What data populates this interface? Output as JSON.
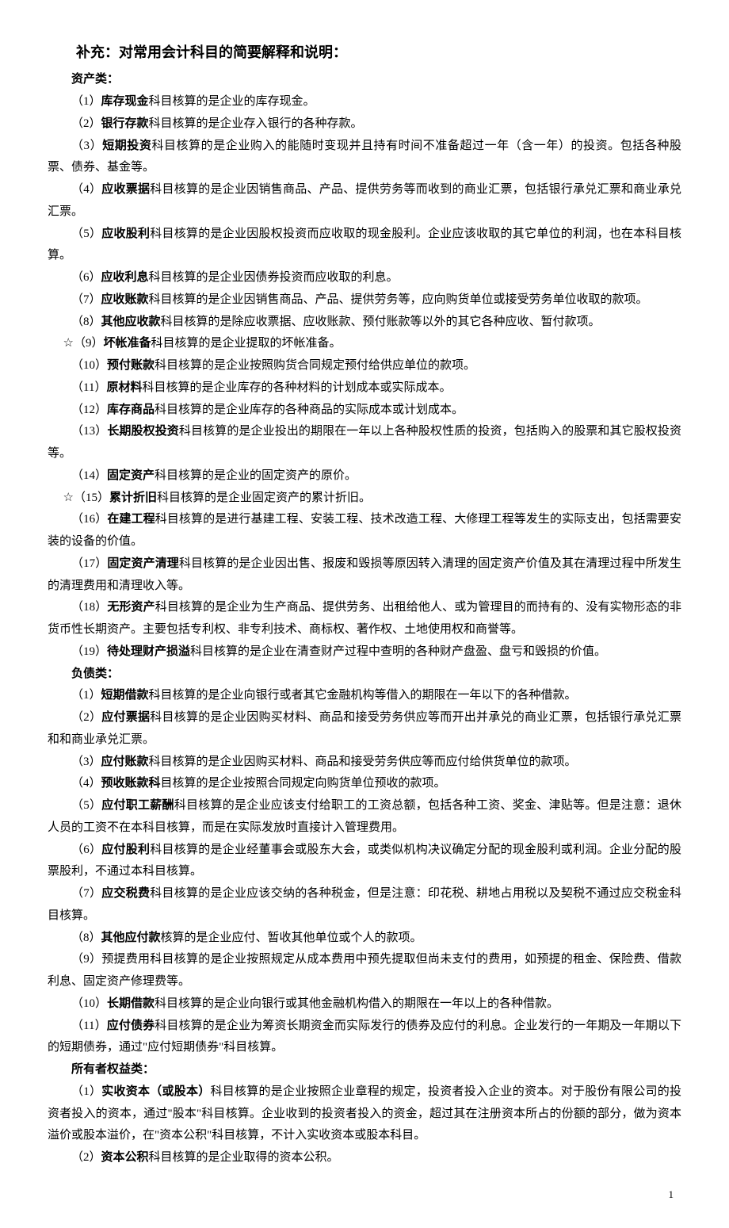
{
  "title": "补充：对常用会计科目的简要解释和说明：",
  "sections": [
    {
      "category": "资产类：",
      "items": [
        {
          "prefix": "（1）",
          "term": "库存现金",
          "rest": "科目核算的是企业的库存现金。"
        },
        {
          "prefix": "（2）",
          "term": "银行存款",
          "rest": "科目核算的是企业存入银行的各种存款。"
        },
        {
          "prefix": "（3）",
          "term": "短期投资",
          "rest": "科目核算的是企业购入的能随时变现并且持有时间不准备超过一年（含一年）的投资。包括各种股票、债券、基金等。"
        },
        {
          "prefix": "（4）",
          "term": "应收票据",
          "rest": "科目核算的是企业因销售商品、产品、提供劳务等而收到的商业汇票，包括银行承兑汇票和商业承兑汇票。"
        },
        {
          "prefix": "（5）",
          "term": "应收股利",
          "rest": "科目核算的是企业因股权投资而应收取的现金股利。企业应该收取的其它单位的利润，也在本科目核算。"
        },
        {
          "prefix": "（6）",
          "term": "应收利息",
          "rest": "科目核算的是企业因债券投资而应收取的利息。"
        },
        {
          "prefix": "（7）",
          "term": "应收账款",
          "rest": "科目核算的是企业因销售商品、产品、提供劳务等，应向购货单位或接受劳务单位收取的款项。"
        },
        {
          "prefix": "（8）",
          "term": "其他应收款",
          "rest": "科目核算的是除应收票据、应收账款、预付账款等以外的其它各种应收、暂付款项。"
        },
        {
          "prefix": "☆（9）",
          "term": "坏帐准备",
          "rest": "科目核算的是企业提取的坏帐准备。",
          "outdent": true
        },
        {
          "prefix": "（10）",
          "term": "预付账款",
          "rest": "科目核算的是企业按照购货合同规定预付给供应单位的款项。"
        },
        {
          "prefix": "（11）",
          "term": "原材料",
          "rest": "科目核算的是企业库存的各种材料的计划成本或实际成本。"
        },
        {
          "prefix": "（12）",
          "term": "库存商品",
          "rest": "科目核算的是企业库存的各种商品的实际成本或计划成本。"
        },
        {
          "prefix": "（13）",
          "term": "长期股权投资",
          "rest": "科目核算的是企业投出的期限在一年以上各种股权性质的投资，包括购入的股票和其它股权投资等。"
        },
        {
          "prefix": "（14）",
          "term": "固定资产",
          "rest": "科目核算的是企业的固定资产的原价。"
        },
        {
          "prefix": "☆（15）",
          "term": "累计折旧",
          "rest": "科目核算的是企业固定资产的累计折旧。",
          "outdent": true
        },
        {
          "prefix": "（16）",
          "term": "在建工程",
          "rest": "科目核算的是进行基建工程、安装工程、技术改造工程、大修理工程等发生的实际支出，包括需要安装的设备的价值。"
        },
        {
          "prefix": "（17）",
          "term": "固定资产清理",
          "rest": "科目核算的是企业因出售、报废和毁损等原因转入清理的固定资产价值及其在清理过程中所发生的清理费用和清理收入等。"
        },
        {
          "prefix": "（18）",
          "term": "无形资产",
          "rest": "科目核算的是企业为生产商品、提供劳务、出租给他人、或为管理目的而持有的、没有实物形态的非货币性长期资产。主要包括专利权、非专利技术、商标权、著作权、土地使用权和商誉等。"
        },
        {
          "prefix": "（19）",
          "term": "待处理财产损溢",
          "rest": "科目核算的是企业在清查财产过程中查明的各种财产盘盈、盘亏和毁损的价值。"
        }
      ]
    },
    {
      "category": "负债类：",
      "items": [
        {
          "prefix": "（1）",
          "term": "短期借款",
          "rest": "科目核算的是企业向银行或者其它金融机构等借入的期限在一年以下的各种借款。"
        },
        {
          "prefix": "（2）",
          "term": "应付票据",
          "rest": "科目核算的是企业因购买材料、商品和接受劳务供应等而开出并承兑的商业汇票，包括银行承兑汇票和和商业承兑汇票。"
        },
        {
          "prefix": "（3）",
          "term": "应付账款",
          "rest": "科目核算的是企业因购买材料、商品和接受劳务供应等而应付给供货单位的款项。"
        },
        {
          "prefix": "（4）",
          "term": "预收账款科",
          "rest": "目核算的是企业按照合同规定向购货单位预收的款项。"
        },
        {
          "prefix": "（5）",
          "term": "应付职工薪酬",
          "rest": "科目核算的是企业应该支付给职工的工资总额，包括各种工资、奖金、津贴等。但是注意：退休人员的工资不在本科目核算，而是在实际发放时直接计入管理费用。"
        },
        {
          "prefix": "（6）",
          "term": "应付股利",
          "rest": "科目核算的是企业经董事会或股东大会，或类似机构决议确定分配的现金股利或利润。企业分配的股票股利，不通过本科目核算。"
        },
        {
          "prefix": "（7）",
          "term": "应交税费",
          "rest": "科目核算的是企业应该交纳的各种税金，但是注意：印花税、耕地占用税以及契税不通过应交税金科目核算。"
        },
        {
          "prefix": "（8）",
          "term": "其他应付款",
          "rest": "核算的是企业应付、暂收其他单位或个人的款项。"
        },
        {
          "prefix": "（9）预提费用科目核算的是企业按照规定从成本费用中预先提取但尚未支付的费用，如预提的租金、保险费、借款利息、固定资产修理费等。",
          "term": "",
          "rest": "",
          "plain": true
        },
        {
          "prefix": "（10）",
          "term": "长期借款",
          "rest": "科目核算的是企业向银行或其他金融机构借入的期限在一年以上的各种借款。"
        },
        {
          "prefix": "（11）",
          "term": "应付债券",
          "rest": "科目核算的是企业为筹资长期资金而实际发行的债券及应付的利息。企业发行的一年期及一年期以下的短期债券，通过\"应付短期债券\"科目核算。"
        }
      ]
    },
    {
      "category": "所有者权益类：",
      "items": [
        {
          "prefix": "（1）",
          "term": "实收资本（或股本）",
          "rest": "科目核算的是企业按照企业章程的规定，投资者投入企业的资本。对于股份有限公司的投资者投入的资本，通过\"股本\"科目核算。企业收到的投资者投入的资金，超过其在注册资本所占的份额的部分，做为资本溢价或股本溢价，在\"资本公积\"科目核算，不计入实收资本或股本科目。"
        },
        {
          "prefix": "（2）",
          "term": "资本公积",
          "rest": "科目核算的是企业取得的资本公积。"
        }
      ]
    }
  ],
  "page_number": "1"
}
